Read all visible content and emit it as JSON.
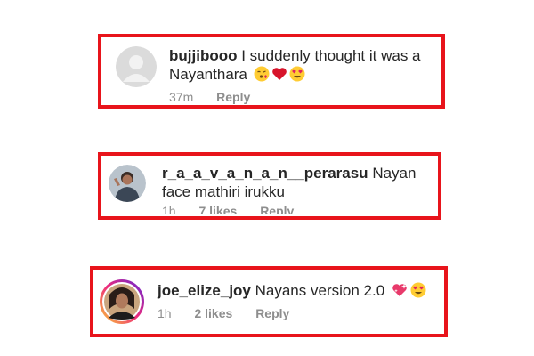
{
  "comments": [
    {
      "username": "bujjibooo",
      "text": "I suddenly thought it was a Nayanthara",
      "emojis": [
        "face-blowing-kiss-icon",
        "red-heart-icon",
        "heart-eyes-icon"
      ],
      "time": "37m",
      "likes": "",
      "reply": "Reply",
      "avatar": "default-avatar-icon"
    },
    {
      "username": "r_a_a_v_a_n_a_n__perarasu",
      "text": "Nayan face mathiri irukku",
      "emojis": [],
      "time": "1h",
      "likes": "7 likes",
      "reply": "Reply",
      "avatar": "profile-photo"
    },
    {
      "username": "joe_elize_joy",
      "text": "Nayans  version  2.0",
      "emojis": [
        "sparkling-heart-icon",
        "heart-eyes-icon"
      ],
      "time": "1h",
      "likes": "2 likes",
      "reply": "Reply",
      "avatar": "story-ring-profile-photo"
    }
  ],
  "colors": {
    "highlight_border": "#e8141b",
    "text": "#262626",
    "meta": "#8e8e8e",
    "story_ring": [
      "#f9ce34",
      "#ee2a7b",
      "#6228d7"
    ]
  }
}
